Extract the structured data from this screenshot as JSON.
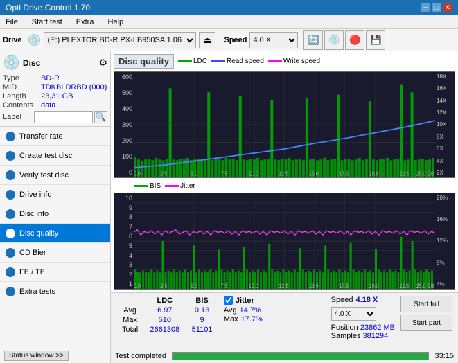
{
  "app": {
    "title": "Opti Drive Control 1.70",
    "titlebar_controls": [
      "─",
      "□",
      "✕"
    ]
  },
  "menu": {
    "items": [
      "File",
      "Start test",
      "Extra",
      "Help"
    ]
  },
  "toolbar": {
    "drive_label": "Drive",
    "drive_value": "(E:)  PLEXTOR BD-R  PX-LB950SA 1.06",
    "speed_label": "Speed",
    "speed_value": "4.0 X"
  },
  "disc_panel": {
    "title": "Disc",
    "type_label": "Type",
    "type_value": "BD-R",
    "mid_label": "MID",
    "mid_value": "TDKBLDRBD (000)",
    "length_label": "Length",
    "length_value": "23,31 GB",
    "contents_label": "Contents",
    "contents_value": "data",
    "label_label": "Label"
  },
  "nav": {
    "items": [
      {
        "id": "transfer-rate",
        "label": "Transfer rate",
        "active": false
      },
      {
        "id": "create-test-disc",
        "label": "Create test disc",
        "active": false
      },
      {
        "id": "verify-test-disc",
        "label": "Verify test disc",
        "active": false
      },
      {
        "id": "drive-info",
        "label": "Drive info",
        "active": false
      },
      {
        "id": "disc-info",
        "label": "Disc info",
        "active": false
      },
      {
        "id": "disc-quality",
        "label": "Disc quality",
        "active": true
      },
      {
        "id": "cd-bier",
        "label": "CD Bier",
        "active": false
      },
      {
        "id": "fe-te",
        "label": "FE / TE",
        "active": false
      },
      {
        "id": "extra-tests",
        "label": "Extra tests",
        "active": false
      }
    ]
  },
  "status_window": {
    "label": "Status window >>"
  },
  "chart1": {
    "title": "Disc quality",
    "legend": [
      {
        "label": "LDC",
        "color": "#00aa00"
      },
      {
        "label": "Read speed",
        "color": "#0000ff"
      },
      {
        "label": "Write speed",
        "color": "#ff00ff"
      }
    ],
    "y_axis_left": [
      "600",
      "500",
      "400",
      "300",
      "200",
      "100",
      "0"
    ],
    "y_axis_right": [
      "18X",
      "16X",
      "14X",
      "12X",
      "10X",
      "8X",
      "6X",
      "4X",
      "2X"
    ],
    "x_axis": [
      "0.0",
      "2.5",
      "5.0",
      "7.5",
      "10.0",
      "12.5",
      "15.0",
      "17.5",
      "20.0",
      "22.5",
      "25.0 GB"
    ]
  },
  "chart2": {
    "legend": [
      {
        "label": "BIS",
        "color": "#00aa00"
      },
      {
        "label": "Jitter",
        "color": "#ff00ff"
      }
    ],
    "y_axis_left": [
      "10",
      "9",
      "8",
      "7",
      "6",
      "5",
      "4",
      "3",
      "2",
      "1"
    ],
    "y_axis_right": [
      "20%",
      "16%",
      "12%",
      "8%",
      "4%"
    ],
    "x_axis": [
      "0.0",
      "2.5",
      "5.0",
      "7.5",
      "10.0",
      "12.5",
      "15.0",
      "17.5",
      "20.0",
      "22.5",
      "25.0 GB"
    ]
  },
  "stats": {
    "ldc_label": "LDC",
    "bis_label": "BIS",
    "jitter_label": "Jitter",
    "jitter_checked": true,
    "speed_label": "Speed",
    "speed_value": "4.18 X",
    "rows": [
      {
        "label": "Avg",
        "ldc": "6.97",
        "bis": "0.13",
        "jitter": "14.7%"
      },
      {
        "label": "Max",
        "ldc": "510",
        "bis": "9",
        "jitter": "17.7%"
      },
      {
        "label": "Total",
        "ldc": "2661308",
        "bis": "51101",
        "jitter": ""
      }
    ],
    "position_label": "Position",
    "position_value": "23862 MB",
    "samples_label": "Samples",
    "samples_value": "381294",
    "speed_select": "4.0 X",
    "start_full": "Start full",
    "start_part": "Start part"
  },
  "bottom": {
    "status_text": "Test completed",
    "progress": 100,
    "time": "33:15"
  }
}
